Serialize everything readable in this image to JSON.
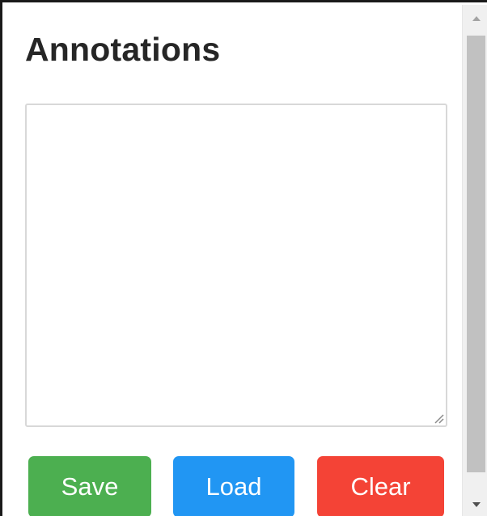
{
  "panel": {
    "title": "Annotations"
  },
  "notes": {
    "value": "",
    "placeholder": ""
  },
  "buttons": {
    "save_label": "Save",
    "load_label": "Load",
    "clear_label": "Clear"
  },
  "colors": {
    "save": "#4caf50",
    "load": "#2196f3",
    "clear": "#f44336"
  },
  "icons": {
    "scroll_up": "arrow-up-icon",
    "scroll_down": "arrow-down-icon",
    "resize": "resize-grip-icon"
  }
}
